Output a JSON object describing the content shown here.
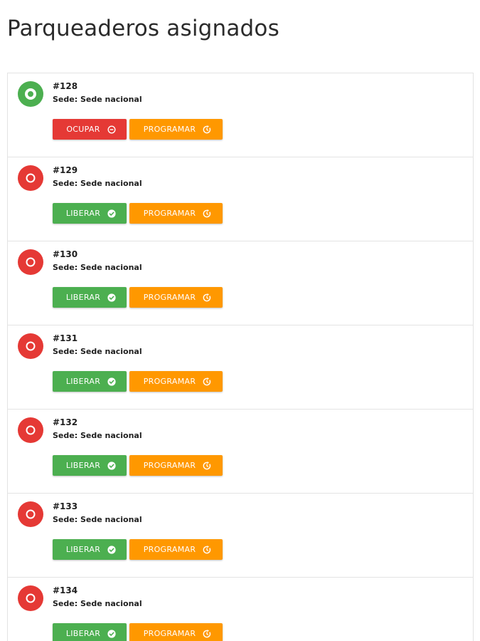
{
  "title": "Parqueaderos asignados",
  "colors": {
    "free": "#4caf50",
    "busy": "#e53935",
    "occupy_button": "#e53935",
    "release_button": "#4caf50",
    "schedule_button": "#ff9800"
  },
  "spots": [
    {
      "number": "#128",
      "site": "Sede: Sede nacional",
      "status": "free",
      "status_icon": "radio-filled-icon",
      "primary_label": "OCUPAR",
      "primary_icon": "minus-circle-icon",
      "schedule_label": "PROGRAMAR",
      "schedule_icon": "clock-history-icon"
    },
    {
      "number": "#129",
      "site": "Sede: Sede nacional",
      "status": "busy",
      "status_icon": "radio-empty-icon",
      "primary_label": "LIBERAR",
      "primary_icon": "check-circle-icon",
      "schedule_label": "PROGRAMAR",
      "schedule_icon": "clock-history-icon"
    },
    {
      "number": "#130",
      "site": "Sede: Sede nacional",
      "status": "busy",
      "status_icon": "radio-empty-icon",
      "primary_label": "LIBERAR",
      "primary_icon": "check-circle-icon",
      "schedule_label": "PROGRAMAR",
      "schedule_icon": "clock-history-icon"
    },
    {
      "number": "#131",
      "site": "Sede: Sede nacional",
      "status": "busy",
      "status_icon": "radio-empty-icon",
      "primary_label": "LIBERAR",
      "primary_icon": "check-circle-icon",
      "schedule_label": "PROGRAMAR",
      "schedule_icon": "clock-history-icon"
    },
    {
      "number": "#132",
      "site": "Sede: Sede nacional",
      "status": "busy",
      "status_icon": "radio-empty-icon",
      "primary_label": "LIBERAR",
      "primary_icon": "check-circle-icon",
      "schedule_label": "PROGRAMAR",
      "schedule_icon": "clock-history-icon"
    },
    {
      "number": "#133",
      "site": "Sede: Sede nacional",
      "status": "busy",
      "status_icon": "radio-empty-icon",
      "primary_label": "LIBERAR",
      "primary_icon": "check-circle-icon",
      "schedule_label": "PROGRAMAR",
      "schedule_icon": "clock-history-icon"
    },
    {
      "number": "#134",
      "site": "Sede: Sede nacional",
      "status": "busy",
      "status_icon": "radio-empty-icon",
      "primary_label": "LIBERAR",
      "primary_icon": "check-circle-icon",
      "schedule_label": "PROGRAMAR",
      "schedule_icon": "clock-history-icon"
    }
  ]
}
